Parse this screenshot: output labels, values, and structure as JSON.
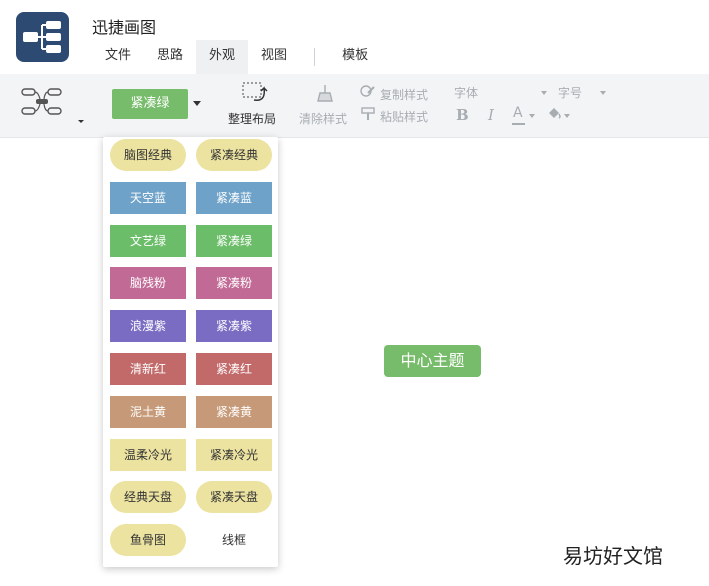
{
  "app": {
    "title": "迅捷画图"
  },
  "menu": [
    {
      "label": "文件",
      "active": false
    },
    {
      "label": "思路",
      "active": false
    },
    {
      "label": "外观",
      "active": true
    },
    {
      "label": "视图",
      "active": false
    },
    {
      "label": "模板",
      "active": false
    }
  ],
  "toolbar": {
    "theme_selected": "紧凑绿",
    "tidy_label": "整理布局",
    "clear_style_label": "清除样式",
    "copy_style_label": "复制样式",
    "paste_style_label": "粘贴样式",
    "font_label": "字体",
    "size_label": "字号",
    "bold": "B",
    "italic": "I",
    "font_color": "A"
  },
  "theme_panel": {
    "themes": [
      {
        "label": "脑图经典",
        "bg": "#ece3a1",
        "color": "#333333",
        "rounded": true
      },
      {
        "label": "紧凑经典",
        "bg": "#ece3a1",
        "color": "#333333",
        "rounded": true
      },
      {
        "label": "天空蓝",
        "bg": "#6ea2c8",
        "color": "#ffffff",
        "rounded": false
      },
      {
        "label": "紧凑蓝",
        "bg": "#6ea2c8",
        "color": "#ffffff",
        "rounded": false
      },
      {
        "label": "文艺绿",
        "bg": "#6cbd6a",
        "color": "#ffffff",
        "rounded": false
      },
      {
        "label": "紧凑绿",
        "bg": "#6cbd6a",
        "color": "#ffffff",
        "rounded": false
      },
      {
        "label": "脑残粉",
        "bg": "#c26a96",
        "color": "#ffffff",
        "rounded": false
      },
      {
        "label": "紧凑粉",
        "bg": "#c26a96",
        "color": "#ffffff",
        "rounded": false
      },
      {
        "label": "浪漫紫",
        "bg": "#7a6cc2",
        "color": "#ffffff",
        "rounded": false
      },
      {
        "label": "紧凑紫",
        "bg": "#7a6cc2",
        "color": "#ffffff",
        "rounded": false
      },
      {
        "label": "清新红",
        "bg": "#c26a6a",
        "color": "#ffffff",
        "rounded": false
      },
      {
        "label": "紧凑红",
        "bg": "#c26a6a",
        "color": "#ffffff",
        "rounded": false
      },
      {
        "label": "泥土黄",
        "bg": "#c69a78",
        "color": "#ffffff",
        "rounded": false
      },
      {
        "label": "紧凑黄",
        "bg": "#c69a78",
        "color": "#ffffff",
        "rounded": false
      },
      {
        "label": "温柔冷光",
        "bg": "#ece3a1",
        "color": "#333333",
        "rounded": false
      },
      {
        "label": "紧凑冷光",
        "bg": "#ece3a1",
        "color": "#333333",
        "rounded": false
      },
      {
        "label": "经典天盘",
        "bg": "#ece3a1",
        "color": "#333333",
        "rounded": true
      },
      {
        "label": "紧凑天盘",
        "bg": "#ece3a1",
        "color": "#333333",
        "rounded": true
      },
      {
        "label": "鱼骨图",
        "bg": "#ece3a1",
        "color": "#333333",
        "rounded": true
      },
      {
        "label": "线框",
        "bg": "#ffffff",
        "color": "#333333",
        "rounded": false
      }
    ]
  },
  "canvas": {
    "central_topic": "中心主题",
    "topic_color": "#76bc6a"
  },
  "watermark": "易坊好文馆"
}
